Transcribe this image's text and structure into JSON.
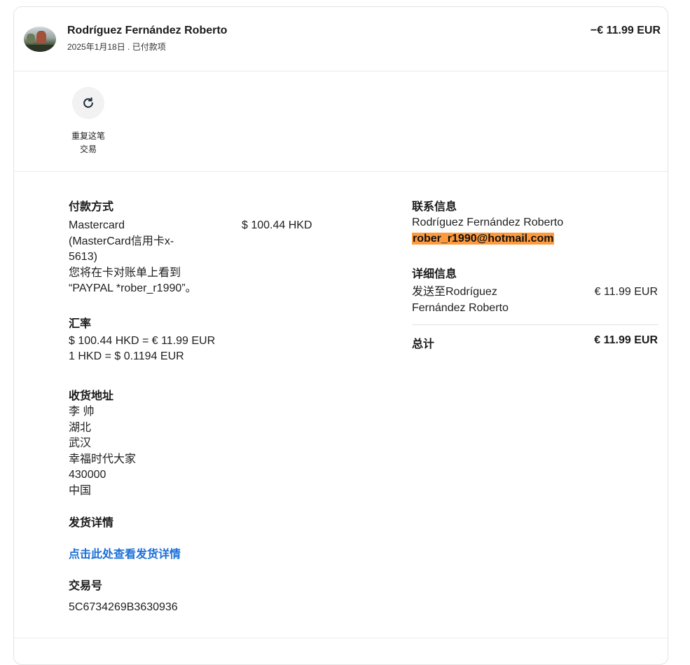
{
  "header": {
    "name": "Rodríguez Fernández Roberto",
    "subtitle": "2025年1月18日 . 已付款项",
    "amount": "−€ 11.99 EUR"
  },
  "actions": {
    "repeat_label_line1": "重复这笔",
    "repeat_label_line2": "交易",
    "repeat_icon": "refresh-icon"
  },
  "payment": {
    "title": "付款方式",
    "method_lines": [
      "Mastercard",
      "(MasterCard信用卡x-",
      "5613)",
      "您将在卡对账单上看到",
      "“PAYPAL *rober_r1990”。"
    ],
    "amount": "$ 100.44 HKD"
  },
  "exchange": {
    "title": "汇率",
    "line1": "$ 100.44 HKD = € 11.99 EUR",
    "line2": "1 HKD = $ 0.1194 EUR"
  },
  "shipping_address": {
    "title": "收货地址",
    "lines": [
      "李 帅",
      "湖北",
      "武汉",
      "幸福时代大家",
      "430000",
      "中国"
    ]
  },
  "shipping_details": {
    "title": "发货详情",
    "link": "点击此处查看发货详情"
  },
  "transaction": {
    "title": "交易号",
    "id": "5C6734269B3630936"
  },
  "contact": {
    "title": "联系信息",
    "name": "Rodríguez Fernández Roberto",
    "email": "rober_r1990@hotmail.com"
  },
  "details": {
    "title": "详细信息",
    "sent_to_line1": "发送至Rodríguez",
    "sent_to_line2": "Fernández Roberto",
    "sent_amount": "€ 11.99 EUR",
    "total_label": "总计",
    "total_amount": "€ 11.99 EUR"
  },
  "colors": {
    "link": "#1b6fd8",
    "email_highlight": "#ff9a3c"
  }
}
